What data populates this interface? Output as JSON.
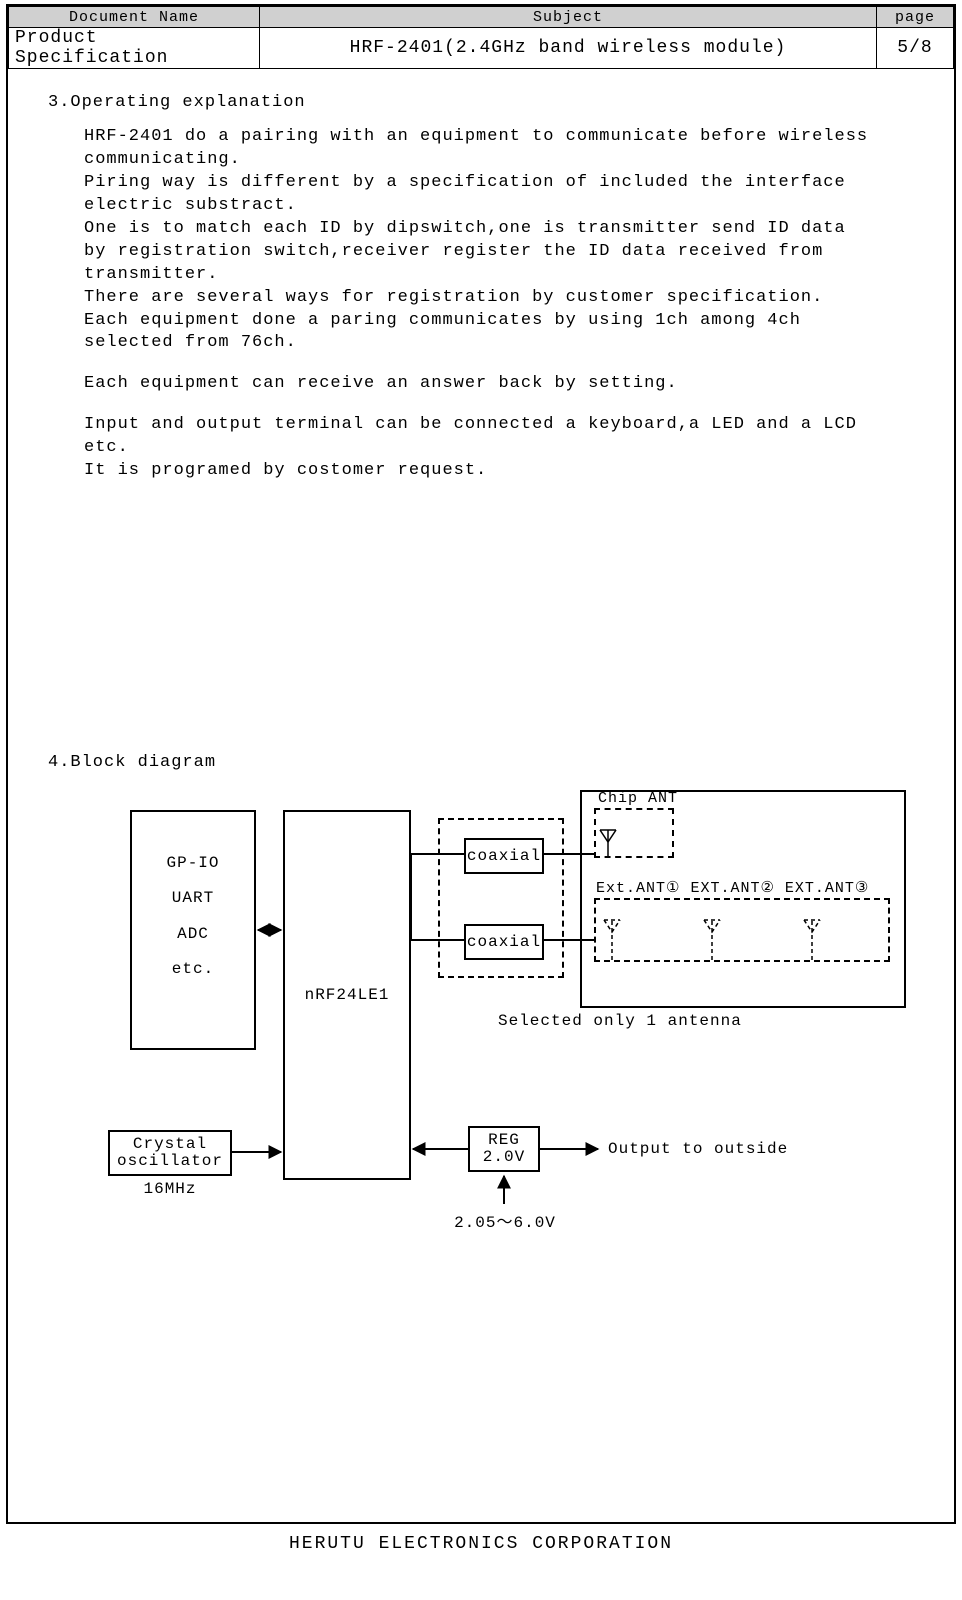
{
  "header": {
    "col_docname": "Document Name",
    "col_subject": "Subject",
    "col_page": "page",
    "docname": "Product Specification",
    "subject": "HRF-2401(2.4GHz band wireless module)",
    "page": "5/8"
  },
  "section3": {
    "title": "3.Operating explanation",
    "p1": "HRF-2401 do a pairing with an equipment to communicate before wireless communicating.",
    "p2": "Piring way is different by a specification of included the interface electric substract.",
    "p3": "One is to match each ID by dipswitch,one is transmitter send ID data by registration switch,receiver register the ID data received from transmitter.",
    "p4": "There are several ways for registration by customer specification.",
    "p5": "Each equipment done a paring communicates by using 1ch among 4ch selected from 76ch.",
    "p6": "Each equipment can receive an answer back by setting.",
    "p7": "Input and output terminal can be connected a keyboard,a LED and a LCD etc.",
    "p8": "It is programed by costomer request."
  },
  "section4": {
    "title": "4.Block diagram"
  },
  "diagram": {
    "gpio": {
      "l1": "GP-IO",
      "l2": "UART",
      "l3": "ADC",
      "l4": "etc."
    },
    "nrf": "nRF24LE1",
    "crystal": "Crystal\noscillator",
    "crystal_freq": "16MHz",
    "coax": "coaxial",
    "chip_ant": "Chip ANT",
    "ext_ant": "Ext.ANT① EXT.ANT② EXT.ANT③",
    "ant_note": "Selected only 1 antenna",
    "reg": "REG\n2.0V",
    "output": "Output to outside",
    "vrange": "2.05～6.0V"
  },
  "footer": "HERUTU ELECTRONICS CORPORATION"
}
